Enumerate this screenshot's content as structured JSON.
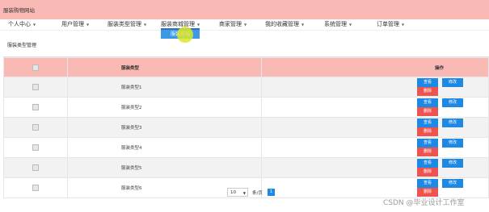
{
  "site": {
    "title": "服装购物网站"
  },
  "nav": [
    {
      "label": "个人中心",
      "active": false
    },
    {
      "label": "用户管理",
      "active": false
    },
    {
      "label": "服装类型管理",
      "active": false
    },
    {
      "label": "服装商城管理",
      "active": true
    },
    {
      "label": "商家管理",
      "active": false
    },
    {
      "label": "我的收藏管理",
      "active": false
    },
    {
      "label": "系统管理",
      "active": false
    },
    {
      "label": "订单管理",
      "active": false
    }
  ],
  "submenu": {
    "label": "服装商城"
  },
  "page": {
    "title": "服装类型管理"
  },
  "table": {
    "headers": {
      "name": "服装类型",
      "ops": "操作"
    },
    "rows": [
      {
        "name": "服装类型1"
      },
      {
        "name": "服装类型2"
      },
      {
        "name": "服装类型3"
      },
      {
        "name": "服装类型4"
      },
      {
        "name": "服装类型5"
      },
      {
        "name": "服装类型6"
      }
    ],
    "buttons": {
      "view": "查看",
      "edit": "修改",
      "delete": "删除"
    }
  },
  "pager": {
    "page_size": "10",
    "per_page_label": "条/页",
    "current_page": "1"
  },
  "watermark": "CSDN @毕业设计工作室",
  "colors": {
    "header_bg": "#f9b9b4",
    "primary": "#1e88e5",
    "danger": "#ef5350"
  }
}
